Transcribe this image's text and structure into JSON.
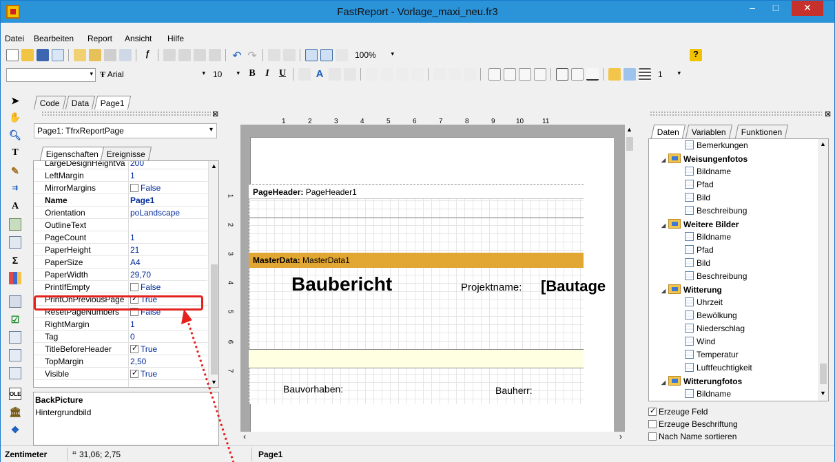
{
  "window": {
    "title": "FastReport - Vorlage_maxi_neu.fr3",
    "min_glyph": "–",
    "max_glyph": "□",
    "close_glyph": "✕"
  },
  "menu": [
    {
      "label": "Datei"
    },
    {
      "label": "Bearbeiten"
    },
    {
      "label": "Report"
    },
    {
      "label": "Ansicht"
    },
    {
      "label": "Hilfe"
    }
  ],
  "toolbar": {
    "zoom": "100%",
    "font_name": "Arial",
    "font_size": "10",
    "bold_glyph": "B",
    "italic_glyph": "I",
    "underline_glyph": "U",
    "frame_width": "1"
  },
  "design_tabs": [
    "Code",
    "Data",
    "Page1"
  ],
  "inspector": {
    "object": "Page1: TfrxReportPage",
    "tabs": [
      "Eigenschaften",
      "Ereignisse"
    ],
    "properties": [
      {
        "name": "LargeDesignHeightVa",
        "value": "200"
      },
      {
        "name": "LeftMargin",
        "value": "1"
      },
      {
        "name": "MirrorMargins",
        "value": "False"
      },
      {
        "name": "Name",
        "value": "Page1"
      },
      {
        "name": "Orientation",
        "value": "poLandscape"
      },
      {
        "name": "OutlineText",
        "value": ""
      },
      {
        "name": "PageCount",
        "value": "1"
      },
      {
        "name": "PaperHeight",
        "value": "21"
      },
      {
        "name": "PaperSize",
        "value": "A4"
      },
      {
        "name": "PaperWidth",
        "value": "29,70"
      },
      {
        "name": "PrintIfEmpty",
        "value": "False"
      },
      {
        "name": "PrintOnPreviousPage",
        "value": "True"
      },
      {
        "name": "ResetPageNumbers",
        "value": "False"
      },
      {
        "name": "RightMargin",
        "value": "1"
      },
      {
        "name": "Tag",
        "value": "0"
      },
      {
        "name": "TitleBeforeHeader",
        "value": "True"
      },
      {
        "name": "TopMargin",
        "value": "2,50"
      },
      {
        "name": "Visible",
        "value": "True"
      }
    ],
    "desc_title": "BackPicture",
    "desc_text": "Hintergrundbild"
  },
  "canvas": {
    "ruler_h": [
      "1",
      "2",
      "3",
      "4",
      "5",
      "6",
      "7",
      "8",
      "9",
      "10",
      "11"
    ],
    "ruler_v": [
      "1",
      "2",
      "3",
      "4",
      "5",
      "6",
      "7"
    ],
    "page_header_label": "PageHeader:",
    "page_header_name": "PageHeader1",
    "master_data_label": "MasterData:",
    "master_data_name": "MasterData1",
    "title": "Baubericht",
    "projektname": "Projektname:",
    "bautage": "[Bautage",
    "bauvorhaben": "Bauvorhaben:",
    "bauherr": "Bauherr:"
  },
  "right_panel": {
    "tabs": [
      "Daten",
      "Variablen",
      "Funktionen"
    ],
    "tree": [
      {
        "label": "Bemerkungen",
        "level": 2,
        "folder": false
      },
      {
        "label": "Weisungenfotos",
        "level": 1,
        "folder": true
      },
      {
        "label": "Bildname",
        "level": 2,
        "folder": false
      },
      {
        "label": "Pfad",
        "level": 2,
        "folder": false
      },
      {
        "label": "Bild",
        "level": 2,
        "folder": false
      },
      {
        "label": "Beschreibung",
        "level": 2,
        "folder": false
      },
      {
        "label": "Weitere Bilder",
        "level": 1,
        "folder": true
      },
      {
        "label": "Bildname",
        "level": 2,
        "folder": false
      },
      {
        "label": "Pfad",
        "level": 2,
        "folder": false
      },
      {
        "label": "Bild",
        "level": 2,
        "folder": false
      },
      {
        "label": "Beschreibung",
        "level": 2,
        "folder": false
      },
      {
        "label": "Witterung",
        "level": 1,
        "folder": true
      },
      {
        "label": "Uhrzeit",
        "level": 2,
        "folder": false
      },
      {
        "label": "Bewölkung",
        "level": 2,
        "folder": false
      },
      {
        "label": "Niederschlag",
        "level": 2,
        "folder": false
      },
      {
        "label": "Wind",
        "level": 2,
        "folder": false
      },
      {
        "label": "Temperatur",
        "level": 2,
        "folder": false
      },
      {
        "label": "Luftfeuchtigkeit",
        "level": 2,
        "folder": false
      },
      {
        "label": "Witterungfotos",
        "level": 1,
        "folder": true
      },
      {
        "label": "Bildname",
        "level": 2,
        "folder": false
      }
    ],
    "opt_create_field": "Erzeuge Feld",
    "opt_create_caption": "Erzeuge Beschriftung",
    "opt_sort_name": "Nach Name sortieren"
  },
  "status": {
    "units": "Zentimeter",
    "coords": "31,06; 2,75",
    "page": "Page1"
  },
  "colors": {
    "titlebar": "#2b93d8",
    "close": "#c7312b",
    "masterdata_band": "#e2a632",
    "highlight": "#e3221e"
  }
}
